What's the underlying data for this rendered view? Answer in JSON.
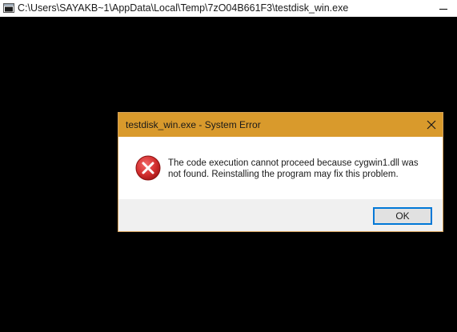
{
  "console_window": {
    "title": "C:\\Users\\SAYAKB~1\\AppData\\Local\\Temp\\7zO04B661F3\\testdisk_win.exe",
    "icon": "console-app-icon"
  },
  "error_dialog": {
    "title": "testdisk_win.exe - System Error",
    "icon": "error-x-icon",
    "message": "The code execution cannot proceed because cygwin1.dll was not found. Reinstalling the program may fix this problem.",
    "ok_label": "OK"
  },
  "colors": {
    "dialog_titlebar": "#d99a2c",
    "error_icon_red": "#d32f2f",
    "button_focus_border": "#0078d7",
    "console_background": "#000000"
  }
}
